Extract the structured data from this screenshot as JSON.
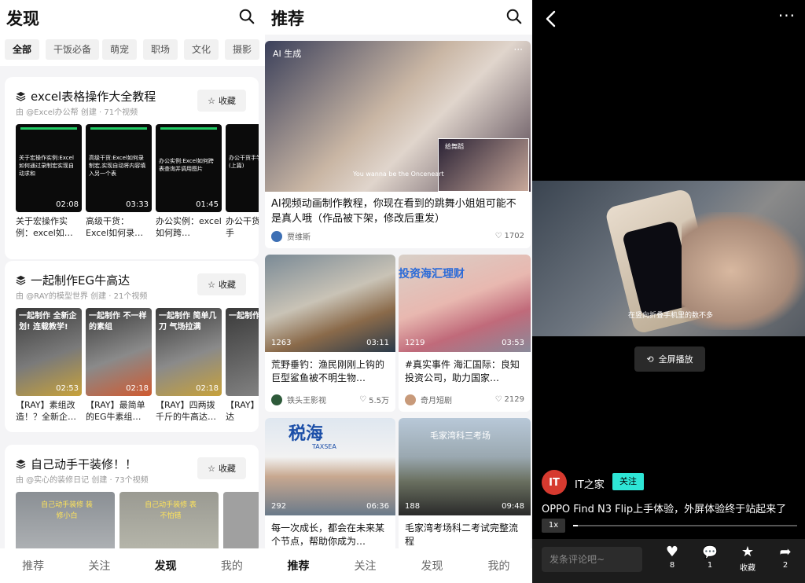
{
  "discover": {
    "title": "发现",
    "categories": [
      "全部",
      "干饭必备",
      "萌宠",
      "职场",
      "文化",
      "摄影"
    ],
    "fav_label": "收藏",
    "collections": [
      {
        "title": "excel表格操作大全教程",
        "subtitle": "由 @Excel办公帮 创建 · 71个视频",
        "videos": [
          {
            "caption": "关于宏操作实例：excel如…",
            "duration": "02:08",
            "overlay": "关于宏操作实例:Excel如何通过录制宏实现自动求和"
          },
          {
            "caption": "高级干货：Excel如何录…",
            "duration": "03:33",
            "overlay": "高级干货:Excel如何录制宏,实现自动将内容填入另一个表"
          },
          {
            "caption": "办公实例：excel如何跨…",
            "duration": "01:45",
            "overlay": "办公实例:Excel如何跨表查询并调用图片"
          },
          {
            "caption": "办公干货快速上手",
            "duration": "",
            "overlay": "办公干货手学会制作表(上篇)"
          }
        ]
      },
      {
        "title": "一起制作EG牛高达",
        "subtitle": "由 @RAY的模型世界 创建 · 21个视频",
        "videos": [
          {
            "caption": "【RAY】素组改造！？全新企…",
            "duration": "02:53",
            "overlay": "一起制作 全新企划! 连载教学!"
          },
          {
            "caption": "【RAY】最简单的EG牛素组…",
            "duration": "02:18",
            "overlay": "一起制作 不一样的素组"
          },
          {
            "caption": "【RAY】四两拨千斤的牛高达…",
            "duration": "02:18",
            "overlay": "一起制作 简单几刀 气场拉满"
          },
          {
            "caption": "【RAY】密的高达",
            "duration": "",
            "overlay": "一起制作"
          }
        ]
      },
      {
        "title": "自己动手干装修！！",
        "subtitle": "由 @实心的装修日记 创建 · 73个视频",
        "videos": [
          {
            "caption": "",
            "duration": "",
            "overlay": "自己动手装修 装修小白"
          },
          {
            "caption": "",
            "duration": "",
            "overlay": "自己动手装修 表不怕错"
          },
          {
            "caption": "",
            "duration": "",
            "overlay": ""
          }
        ]
      }
    ]
  },
  "recommend": {
    "title": "推荐",
    "hero": {
      "badge": "AI 生成",
      "subtitle_text": "You wanna be the Onceneart",
      "inset_label": "给舞蹈",
      "title": "AI视频动画制作教程，你现在看到的跳舞小姐姐可能不是真人哦（作品被下架，修改后重发）",
      "author": "贾维斯",
      "likes": "1702"
    },
    "items": [
      {
        "title": "荒野垂钓：渔民刚刚上钩的巨型鲨鱼被不明生物…",
        "author": "铁头王影视",
        "likes": "5.5万",
        "views": "1263",
        "duration": "03:11"
      },
      {
        "title": "#真实事件 海汇国际：良知投资公司，助力国家…",
        "author": "奇月短剧",
        "likes": "2129",
        "views": "1219",
        "duration": "03:53",
        "overlay": "投资海汇理财"
      },
      {
        "title": "每一次成长，都会在未来某个节点，帮助你成为…",
        "author": "",
        "likes": "",
        "views": "292",
        "duration": "06:36",
        "overlay": "税海",
        "overlay_small": "TAXSEA"
      },
      {
        "title": "毛家湾考场科二考试完整流程",
        "author": "",
        "likes": "",
        "views": "188",
        "duration": "09:48",
        "overlay": "毛家湾科三考场"
      }
    ]
  },
  "player": {
    "video_caption": "在竖向折叠手机里的数不多",
    "fullscreen_label": "全屏播放",
    "channel_name": "IT之家",
    "channel_logo": "IT",
    "follow_label": "关注",
    "video_title": "OPPO Find N3 Flip上手体验，外屏体验终于站起来了",
    "speed": "1x",
    "progress": 0.02,
    "comment_placeholder": "发条评论吧~",
    "actions": [
      {
        "icon": "heart-icon",
        "label": "8"
      },
      {
        "icon": "comment-icon",
        "label": "1"
      },
      {
        "icon": "star-icon",
        "label": "收藏"
      },
      {
        "icon": "share-icon",
        "label": "2"
      }
    ]
  },
  "nav": [
    "推荐",
    "关注",
    "发现",
    "我的"
  ],
  "colors": {
    "accent_follow": "#2ee6d6",
    "channel_logo": "#d63a2f"
  }
}
